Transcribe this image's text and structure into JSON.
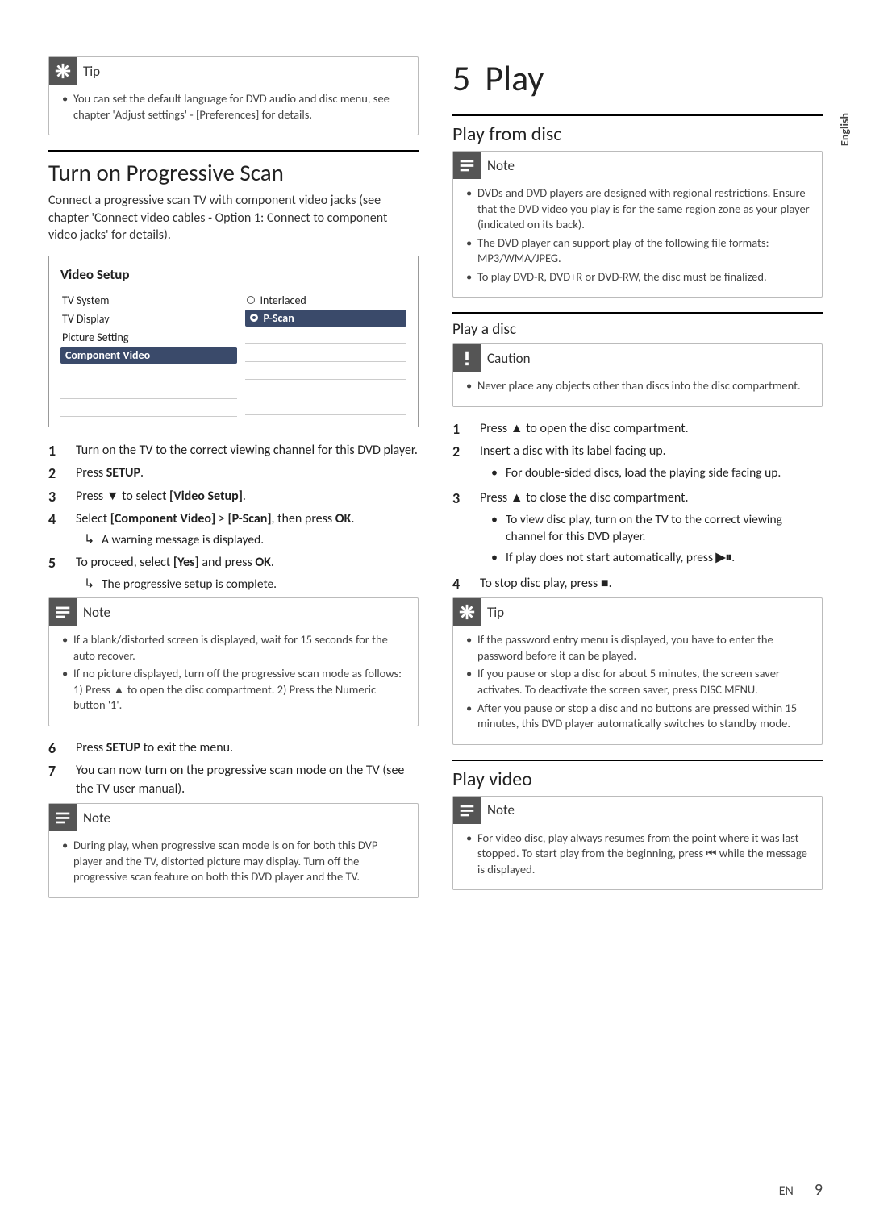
{
  "edge_label": "English",
  "footer": {
    "lang": "EN",
    "page": "9"
  },
  "left": {
    "tip1": {
      "title": "Tip",
      "items": [
        "You can set the default language for DVD audio and disc menu, see chapter 'Adjust settings' - [Preferences] for details."
      ]
    },
    "heading_progressive": "Turn on Progressive Scan",
    "intro_progressive": "Connect a progressive scan TV with component video jacks (see chapter 'Connect video cables - Option 1: Connect to component video jacks' for details).",
    "menu": {
      "title": "Video Setup",
      "left_items": [
        "TV System",
        "TV Display",
        "Picture Setting",
        "Component Video"
      ],
      "right_items": [
        "Interlaced",
        "P-Scan"
      ]
    },
    "steps_a": {
      "s1": "Turn on the TV to the correct viewing channel for this DVD player.",
      "s2_a": "Press ",
      "s2_b": "SETUP",
      "s2_c": ".",
      "s3_a": "Press ",
      "s3_arrow": "▼",
      "s3_b": " to select ",
      "s3_c": "[Video Setup]",
      "s3_d": ".",
      "s4_a": "Select ",
      "s4_b": "[Component Video]",
      "s4_c": " > ",
      "s4_d": "[P-Scan]",
      "s4_e": ", then press ",
      "s4_f": "OK",
      "s4_g": ".",
      "s4_sub": "A warning message is displayed.",
      "s5_a": "To proceed, select ",
      "s5_b": "[Yes]",
      "s5_c": " and press ",
      "s5_d": "OK",
      "s5_e": ".",
      "s5_sub": "The progressive setup is complete."
    },
    "note1": {
      "title": "Note",
      "items": [
        "If a blank/distorted screen is displayed, wait for 15 seconds for the auto recover.",
        "If no picture displayed, turn off the progressive scan mode as follows: 1) Press ▲ to open the disc compartment. 2) Press the Numeric button '1'."
      ]
    },
    "steps_b": {
      "s6_a": "Press ",
      "s6_b": "SETUP",
      "s6_c": " to exit the menu.",
      "s7": "You can now turn on the progressive scan mode on the TV (see the TV user manual)."
    },
    "note2": {
      "title": "Note",
      "items": [
        "During play, when progressive scan mode is on for both this DVP player and the TV, distorted picture may display. Turn off the progressive scan feature on both this DVD player and the TV."
      ]
    }
  },
  "right": {
    "chapter_num": "5",
    "chapter_title": "Play",
    "heading_playfromdisc": "Play from disc",
    "note3": {
      "title": "Note",
      "items": [
        "DVDs and DVD players are designed with regional restrictions. Ensure that the DVD video you play is for the same region zone as your player (indicated on its back).",
        "The DVD player can support play of the following file formats: MP3/WMA/JPEG.",
        "To play DVD-R, DVD+R or DVD-RW, the disc must be finalized."
      ]
    },
    "heading_playdisc": "Play a disc",
    "caution1": {
      "title": "Caution",
      "items": [
        "Never place any objects other than discs into the disc compartment."
      ]
    },
    "steps_c": {
      "s1_a": "Press ",
      "s1_eject": "▲",
      "s1_b": " to open the disc compartment.",
      "s2": "Insert a disc with its label facing up.",
      "s2_sub": "For double-sided discs, load the playing side facing up.",
      "s3_a": "Press ",
      "s3_eject": "▲",
      "s3_b": " to close the disc compartment.",
      "s3_sub1": "To view disc play, turn on the TV to the correct viewing channel for this DVD player.",
      "s3_sub2_a": "If play does not start automatically, press ",
      "s3_sub2_glyph": "▶⏸",
      "s3_sub2_b": ".",
      "s4_a": "To stop disc play, press ",
      "s4_stop": "■",
      "s4_b": "."
    },
    "tip2": {
      "title": "Tip",
      "items": [
        "If the password entry menu is displayed, you have to enter the password before it can be played.",
        "If you pause or stop a disc for about 5 minutes, the screen saver activates. To deactivate the screen saver, press DISC MENU.",
        "After you pause or stop a disc and no buttons are pressed within 15 minutes, this DVD player automatically switches to standby mode."
      ]
    },
    "heading_playvideo": "Play video",
    "note4": {
      "title": "Note",
      "items": [
        "For video disc, play always resumes from the point where it was last stopped. To start play from the beginning, press ⏮ while the message is displayed."
      ]
    }
  }
}
